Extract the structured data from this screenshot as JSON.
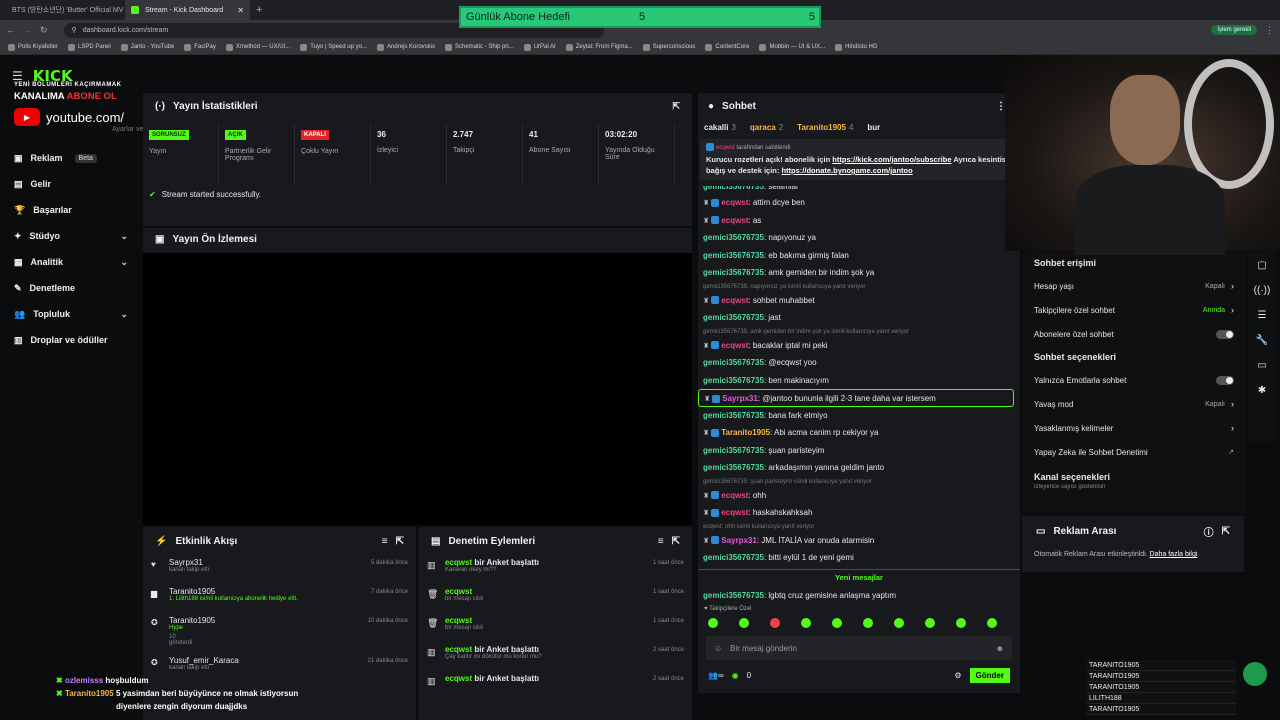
{
  "browser": {
    "tabs": [
      {
        "label": "BTS (방탄소년단) 'Butter' Official MV"
      },
      {
        "label": "Stream - Kick Dashboard"
      }
    ],
    "url": "dashboard.kick.com/stream",
    "update_button": "İşlem gerekli",
    "bookmarks": [
      "Polis Kıyafetler",
      "LSPD Panel",
      "Janto - YouTube",
      "FaciPay",
      "Xmethod — UX/UI...",
      "Tuyo | Speed up yo...",
      "Andrejs Korovskis",
      "Schematic - Ship pri...",
      "UrPal AI",
      "Zeytal: From Figma...",
      "Superconscious",
      "ContentCore",
      "Mobbin — UI & UX...",
      "Hindisto HG"
    ]
  },
  "overlay": {
    "goal_label": "Günlük Abone Hedefi",
    "goal_current": "5",
    "goal_target": "5",
    "promo_line1": "YENİ BÖLÜMLERİ KAÇIRMAMAK",
    "promo_line2": "KANALIMA",
    "promo_abone": "ABONE OL",
    "youtube": "youtube.com/",
    "bottom_chat": [
      {
        "user": "ozlemisss",
        "msg": "hoşbuldum"
      },
      {
        "user": "Taranito1905",
        "msg": "5 yasimdan beri büyüyünce ne olmak istiyorsun"
      },
      {
        "user": "",
        "msg": "diyenlere zengin diyorum duajjdks"
      }
    ],
    "leaderboard": [
      "TARANITO1905",
      "TARANITO1905",
      "TARANITO1905",
      "LILITH188",
      "TARANITO1905"
    ]
  },
  "sidebar": {
    "logo": "KICK",
    "partial": "Ayarlar ve Anahtar",
    "items": [
      {
        "label": "Reklam",
        "badge": "Beta"
      },
      {
        "label": "Gelir"
      },
      {
        "label": "Başarılar"
      },
      {
        "label": "Stüdyo",
        "chev": "⌄"
      },
      {
        "label": "Analitik",
        "chev": "⌄"
      },
      {
        "label": "Denetleme"
      },
      {
        "label": "Topluluk",
        "chev": "⌄"
      },
      {
        "label": "Droplar ve ödüller"
      }
    ]
  },
  "stats": {
    "title": "Yayın İstatistikleri",
    "items": [
      {
        "badge": "SORUNSUZ",
        "label": "Yayın"
      },
      {
        "badge": "AÇIK",
        "label": "Partnerlik Gelir Programı"
      },
      {
        "badge": "KAPALI",
        "label": "Çoklu Yayın"
      },
      {
        "value": "36",
        "label": "İzleyici"
      },
      {
        "value": "2.747",
        "label": "Takipçi"
      },
      {
        "value": "41",
        "label": "Abone Sayısı"
      },
      {
        "value": "03:02:20",
        "label": "Yayında Olduğu Süre"
      }
    ],
    "success": "Stream started successfully.",
    "preview_title": "Yayın Ön İzlemesi"
  },
  "activity": {
    "title": "Etkinlik Akışı",
    "rows": [
      {
        "user": "Sayrpx31",
        "sub": "kanalı takip etti",
        "time": "5 dakika önce"
      },
      {
        "user": "Taranito1905",
        "sub": "1, Lilith188 isimli kullanıcıya abonelik hediye etti.",
        "time": "7 dakika önce"
      },
      {
        "user": "Taranito1905",
        "sub": "Hype",
        "extra": "10",
        "extra2": "gönderdi",
        "time": "10 dakika önce"
      },
      {
        "user": "Yusuf_emir_Karaca",
        "sub": "kanalı takip etti",
        "time": "21 dakika önce"
      }
    ]
  },
  "moderation": {
    "title": "Denetim Eylemleri",
    "rows": [
      {
        "user": "ecqwst",
        "action": "bir Anket başlattı",
        "sub": "Karavan okey mi??",
        "time": "1 saat önce"
      },
      {
        "user": "ecqwst",
        "action": "",
        "sub": "bir mesajı sildi",
        "time": "1 saat önce"
      },
      {
        "user": "ecqwst",
        "action": "",
        "sub": "bir mesajı sildi",
        "time": "1 saat önce"
      },
      {
        "user": "ecqwst",
        "action": "bir Anket başlattı",
        "sub": "Çay katılır mı dökülür mü konur mu?",
        "time": "2 saat önce"
      },
      {
        "user": "ecqwst",
        "action": "bir Anket başlattı",
        "sub": "",
        "time": "2 saat önce"
      }
    ]
  },
  "chat": {
    "title": "Sohbet",
    "top": [
      {
        "user": "cakalli",
        "n": "3"
      },
      {
        "user": "qaraca",
        "n": "2"
      },
      {
        "user": "Taranito1905",
        "n": "4"
      },
      {
        "user": "bur",
        "n": ""
      }
    ],
    "pinned_by": "ecqwst",
    "pinned_suffix": "tarafından sabitlendi",
    "pinned_text": "Kurucu rozetleri açık! abonelik için",
    "pinned_link": "https://kick.com/jantoo/subscribe",
    "pinned_text2": "Ayrıca kesintisiz bağış ve destek için:",
    "pinned_link2": "https://donate.bynogame.com/jantoo",
    "lines": [
      {
        "type": "msg",
        "user": "gemici35676735",
        "msg": "selamlar",
        "color": "#52d9a0",
        "cut": true
      },
      {
        "type": "msg",
        "user": "ecqwst",
        "msg": "attim dcye ben",
        "color": "#f0457a",
        "badges": true
      },
      {
        "type": "msg",
        "user": "ecqwst",
        "msg": "as",
        "color": "#f0457a",
        "badges": true
      },
      {
        "type": "msg",
        "user": "gemici35676735",
        "msg": "napıyonuz ya",
        "color": "#52d9a0"
      },
      {
        "type": "msg",
        "user": "gemici35676735",
        "msg": "eb bakıma girmiş falan",
        "color": "#52d9a0"
      },
      {
        "type": "msg",
        "user": "gemici35676735",
        "msg": "amk gemiden bir indim şok ya",
        "color": "#52d9a0"
      },
      {
        "type": "reply",
        "text": "gemici35676735: napıyonuz ya isimli kullanıcıya yanıt veriyor"
      },
      {
        "type": "msg",
        "user": "ecqwst",
        "msg": "sohbet muhabbet",
        "color": "#f0457a",
        "badges": true
      },
      {
        "type": "msg",
        "user": "gemici35676735",
        "msg": "jast",
        "color": "#52d9a0"
      },
      {
        "type": "reply",
        "text": "gemici35676735: amk gemiden bir indim şok ya isimli kullanıcıya yanıt veriyor"
      },
      {
        "type": "msg",
        "user": "ecqwst",
        "msg": "bacaklar iptal mi peki",
        "color": "#f0457a",
        "badges": true
      },
      {
        "type": "msg",
        "user": "gemici35676735",
        "msg": "@ecqwst yoo",
        "color": "#52d9a0"
      },
      {
        "type": "msg",
        "user": "gemici35676735",
        "msg": "ben makinacıyım",
        "color": "#52d9a0"
      },
      {
        "type": "hl",
        "user": "Sayrpx31",
        "msg": "@jantoo bununla ilgili 2-3 tane daha var istersem",
        "color": "#e35ae0"
      },
      {
        "type": "msg",
        "user": "gemici35676735",
        "msg": "bana fark etmiyo",
        "color": "#52d9a0"
      },
      {
        "type": "msg",
        "user": "Taranito1905",
        "msg": "Abi acma canim rp cekiyor ya",
        "color": "#f4b942",
        "badges": true
      },
      {
        "type": "msg",
        "user": "gemici35676735",
        "msg": "şuan paristeyim",
        "color": "#52d9a0"
      },
      {
        "type": "msg",
        "user": "gemici35676735",
        "msg": "arkadaşımın yanına geldim janto",
        "color": "#52d9a0"
      },
      {
        "type": "reply",
        "text": "gemici35676735: şuan paristeyim isimli kullanıcıya yanıt veriyor"
      },
      {
        "type": "msg",
        "user": "ecqwst",
        "msg": "ohh",
        "color": "#f0457a",
        "badges": true
      },
      {
        "type": "msg",
        "user": "ecqwst",
        "msg": "haskahskahksah",
        "color": "#f0457a",
        "badges": true
      },
      {
        "type": "reply",
        "text": "ecqwst: ohh isimli kullanıcıya yanıt veriyor"
      },
      {
        "type": "msg",
        "user": "Sayrpx31",
        "msg": "JML İTALİA var onuda atarmisin",
        "color": "#e35ae0",
        "badges": true
      },
      {
        "type": "msg",
        "user": "gemici35676735",
        "msg": "bitti eylül 1 de yeni gemi",
        "color": "#52d9a0"
      },
      {
        "type": "sep",
        "text": "Yeni mesajlar"
      },
      {
        "type": "msg",
        "user": "gemici35676735",
        "msg": "lgbtq cruz gemisine anlaşma yaptım",
        "color": "#52d9a0"
      }
    ],
    "mode_label": "Takipçilere Özel",
    "input_placeholder": "Bir mesaj gönderin",
    "points": "0",
    "send": "Gönder"
  },
  "settings": {
    "access_title": "Sohbet erişimi",
    "rows1": [
      {
        "label": "Hesap yaşı",
        "value": "Kapalı"
      },
      {
        "label": "Takipçilere özel sohbet",
        "value": "Anında"
      },
      {
        "label": "Abonelere özel sohbet",
        "toggle": true
      }
    ],
    "options_title": "Sohbet seçenekleri",
    "rows2": [
      {
        "label": "Yalnızca Emotlarla sohbet",
        "toggle": true
      },
      {
        "label": "Yavaş mod",
        "value": "Kapalı"
      },
      {
        "label": "Yasaklanmış kelimeler",
        "value": ""
      },
      {
        "label": "Yapay Zeka ile Sohbet Denetimi",
        "value": "↗"
      }
    ],
    "channel_title": "Kanal seçenekleri",
    "channel_partial": "İzleyence sayısı gösterilsin"
  },
  "ads": {
    "title": "Reklam Arası",
    "text": "Otomatik Reklam Arası etkinleştirildi.",
    "link": "Daha fazla bilgi"
  },
  "colors": {
    "kick_green": "#53fc18",
    "panel": "#18191c",
    "bg": "#0b0c0e"
  }
}
